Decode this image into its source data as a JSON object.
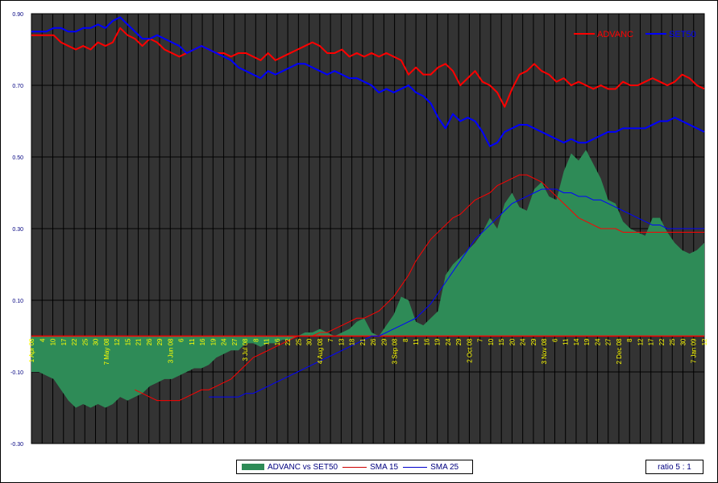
{
  "chart_data": {
    "type": "area",
    "title": "",
    "xlabel": "",
    "ylabel": "",
    "ylim": [
      -0.3,
      0.9
    ],
    "yticks": [
      "0.90",
      "0.70",
      "0.50",
      "0.30",
      "0.10",
      "-0.10",
      "-0.30"
    ],
    "yticks_values": [
      0.9,
      0.7,
      0.5,
      0.3,
      0.1,
      -0.1,
      -0.3
    ],
    "x_start": "1 Apr 08",
    "x_end": "12 Jan 09",
    "xtick_labels": [
      "1 Apr 08",
      "4",
      "10",
      "17",
      "22",
      "25",
      "30",
      "7 May 08",
      "12",
      "15",
      "21",
      "26",
      "29",
      "3 Jun 08",
      "6",
      "11",
      "16",
      "19",
      "24",
      "27",
      "3 Jul 08",
      "8",
      "11",
      "16",
      "22",
      "25",
      "30",
      "4 Aug 08",
      "7",
      "13",
      "18",
      "21",
      "26",
      "29",
      "3 Sep 08",
      "8",
      "11",
      "16",
      "19",
      "24",
      "29",
      "2 Oct 08",
      "7",
      "10",
      "15",
      "20",
      "24",
      "29",
      "3 Nov 08",
      "6",
      "11",
      "14",
      "19",
      "24",
      "27",
      "2 Dec 08",
      "8",
      "12",
      "17",
      "22",
      "25",
      "30",
      "7 Jan 09",
      "12"
    ],
    "xtick_highlight": [
      "1 Apr 08",
      "7 May 08",
      "3 Jun 08",
      "3 Jul 08",
      "4 Aug 08",
      "3 Sep 08",
      "2 Oct 08",
      "3 Nov 08",
      "2 Dec 08",
      "7 Jan 09"
    ],
    "grid": true,
    "legend_position": "top-right",
    "series": [
      {
        "name": "ADVANC",
        "type": "line",
        "color": "#ff0000",
        "values": [
          0.84,
          0.84,
          0.84,
          0.84,
          0.82,
          0.81,
          0.8,
          0.81,
          0.8,
          0.82,
          0.81,
          0.82,
          0.86,
          0.84,
          0.83,
          0.81,
          0.83,
          0.82,
          0.8,
          0.79,
          0.78,
          0.79,
          0.8,
          0.81,
          0.8,
          0.79,
          0.79,
          0.78,
          0.79,
          0.79,
          0.78,
          0.77,
          0.79,
          0.77,
          0.78,
          0.79,
          0.8,
          0.81,
          0.82,
          0.81,
          0.79,
          0.79,
          0.8,
          0.78,
          0.79,
          0.78,
          0.79,
          0.78,
          0.79,
          0.78,
          0.77,
          0.73,
          0.75,
          0.73,
          0.73,
          0.75,
          0.76,
          0.74,
          0.7,
          0.72,
          0.74,
          0.71,
          0.7,
          0.68,
          0.64,
          0.69,
          0.73,
          0.74,
          0.76,
          0.74,
          0.73,
          0.71,
          0.72,
          0.7,
          0.71,
          0.7,
          0.69,
          0.7,
          0.69,
          0.69,
          0.71,
          0.7,
          0.7,
          0.71,
          0.72,
          0.71,
          0.7,
          0.71,
          0.73,
          0.72,
          0.7,
          0.69
        ]
      },
      {
        "name": "SET50",
        "type": "line",
        "color": "#0000ff",
        "values": [
          0.85,
          0.85,
          0.85,
          0.86,
          0.86,
          0.85,
          0.85,
          0.86,
          0.86,
          0.87,
          0.86,
          0.88,
          0.89,
          0.87,
          0.85,
          0.83,
          0.83,
          0.84,
          0.83,
          0.82,
          0.81,
          0.79,
          0.8,
          0.81,
          0.8,
          0.79,
          0.78,
          0.77,
          0.75,
          0.74,
          0.73,
          0.72,
          0.74,
          0.73,
          0.74,
          0.75,
          0.76,
          0.76,
          0.75,
          0.74,
          0.73,
          0.74,
          0.73,
          0.72,
          0.72,
          0.71,
          0.7,
          0.68,
          0.69,
          0.68,
          0.69,
          0.7,
          0.68,
          0.67,
          0.65,
          0.61,
          0.58,
          0.62,
          0.6,
          0.61,
          0.6,
          0.57,
          0.53,
          0.54,
          0.57,
          0.58,
          0.59,
          0.59,
          0.58,
          0.57,
          0.56,
          0.55,
          0.54,
          0.55,
          0.54,
          0.54,
          0.55,
          0.56,
          0.57,
          0.57,
          0.58,
          0.58,
          0.58,
          0.58,
          0.59,
          0.6,
          0.6,
          0.61,
          0.6,
          0.59,
          0.58,
          0.57
        ]
      },
      {
        "name": "ADVANC vs SET50",
        "type": "area",
        "color": "#2e8b57",
        "values": [
          -0.1,
          -0.1,
          -0.11,
          -0.12,
          -0.15,
          -0.18,
          -0.2,
          -0.19,
          -0.2,
          -0.19,
          -0.2,
          -0.19,
          -0.17,
          -0.18,
          -0.17,
          -0.16,
          -0.14,
          -0.13,
          -0.12,
          -0.12,
          -0.11,
          -0.1,
          -0.09,
          -0.09,
          -0.08,
          -0.06,
          -0.05,
          -0.04,
          -0.04,
          -0.02,
          -0.02,
          -0.03,
          -0.02,
          -0.02,
          -0.01,
          -0.01,
          0.0,
          0.01,
          0.01,
          0.02,
          0.01,
          0.0,
          0.01,
          0.02,
          0.04,
          0.05,
          0.01,
          0.0,
          0.03,
          0.06,
          0.11,
          0.1,
          0.04,
          0.03,
          0.05,
          0.07,
          0.17,
          0.2,
          0.22,
          0.24,
          0.26,
          0.29,
          0.33,
          0.3,
          0.37,
          0.4,
          0.36,
          0.35,
          0.41,
          0.43,
          0.39,
          0.38,
          0.46,
          0.51,
          0.49,
          0.52,
          0.48,
          0.44,
          0.38,
          0.37,
          0.32,
          0.3,
          0.29,
          0.28,
          0.33,
          0.33,
          0.29,
          0.26,
          0.24,
          0.23,
          0.24,
          0.26
        ]
      },
      {
        "name": "SMA 15",
        "type": "line",
        "color": "#ff0000",
        "values": [
          null,
          null,
          null,
          null,
          null,
          null,
          null,
          null,
          null,
          null,
          null,
          null,
          null,
          null,
          -0.15,
          -0.16,
          -0.17,
          -0.18,
          -0.18,
          -0.18,
          -0.18,
          -0.17,
          -0.16,
          -0.15,
          -0.15,
          -0.14,
          -0.13,
          -0.12,
          -0.1,
          -0.08,
          -0.06,
          -0.05,
          -0.04,
          -0.03,
          -0.02,
          -0.01,
          0.0,
          0.0,
          0.0,
          0.01,
          0.01,
          0.02,
          0.03,
          0.04,
          0.05,
          0.05,
          0.06,
          0.07,
          0.09,
          0.11,
          0.14,
          0.17,
          0.21,
          0.24,
          0.27,
          0.29,
          0.31,
          0.33,
          0.34,
          0.36,
          0.38,
          0.39,
          0.4,
          0.42,
          0.43,
          0.44,
          0.45,
          0.45,
          0.44,
          0.43,
          0.41,
          0.39,
          0.37,
          0.35,
          0.33,
          0.32,
          0.31,
          0.3,
          0.3,
          0.3,
          0.29,
          0.29,
          0.29,
          0.29,
          0.29,
          0.29,
          0.29,
          0.29,
          0.29,
          0.29,
          0.29,
          0.29
        ]
      },
      {
        "name": "SMA 25",
        "type": "line",
        "color": "#0000ff",
        "values": [
          null,
          null,
          null,
          null,
          null,
          null,
          null,
          null,
          null,
          null,
          null,
          null,
          null,
          null,
          null,
          null,
          null,
          null,
          null,
          null,
          null,
          null,
          null,
          null,
          -0.17,
          -0.17,
          -0.17,
          -0.17,
          -0.17,
          -0.16,
          -0.16,
          -0.15,
          -0.14,
          -0.13,
          -0.12,
          -0.11,
          -0.1,
          -0.09,
          -0.08,
          -0.07,
          -0.06,
          -0.05,
          -0.04,
          -0.03,
          -0.02,
          -0.01,
          0.0,
          0.0,
          0.01,
          0.02,
          0.03,
          0.04,
          0.05,
          0.07,
          0.09,
          0.12,
          0.15,
          0.18,
          0.21,
          0.24,
          0.27,
          0.29,
          0.31,
          0.33,
          0.35,
          0.37,
          0.38,
          0.39,
          0.4,
          0.41,
          0.41,
          0.41,
          0.4,
          0.4,
          0.39,
          0.39,
          0.38,
          0.38,
          0.37,
          0.36,
          0.35,
          0.34,
          0.33,
          0.32,
          0.31,
          0.31,
          0.3,
          0.3,
          0.3,
          0.3,
          0.3,
          0.3
        ]
      }
    ]
  },
  "legend_top": {
    "advanc_label": "ADVANC",
    "set50_label": "SET50"
  },
  "legend_bottom": {
    "area_label": "ADVANC vs SET50",
    "sma15_label": "SMA 15",
    "sma25_label": "SMA 25"
  },
  "ratio_label": "ratio 5 : 1",
  "colors": {
    "plot_bg": "#333333",
    "grid": "#000000",
    "area": "#2e8b57",
    "zero_line": "#ff0000",
    "tick_yellow": "#ffff00",
    "axis_text": "#000080"
  }
}
